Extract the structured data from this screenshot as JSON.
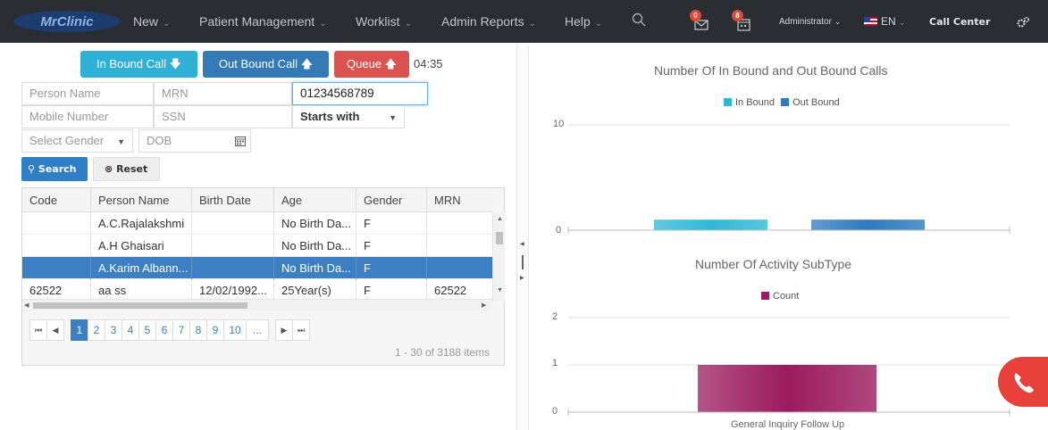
{
  "navbar": {
    "logo_text": "MrClinic",
    "menu": [
      {
        "label": "New"
      },
      {
        "label": "Patient Management"
      },
      {
        "label": "Worklist"
      },
      {
        "label": "Admin Reports"
      },
      {
        "label": "Help"
      }
    ],
    "mail_badge": "0",
    "calendar_badge": "8",
    "user": "Administrator",
    "language": "EN",
    "call_center": "Call Center"
  },
  "call_buttons": {
    "inbound": "In Bound Call",
    "outbound": "Out Bound Call",
    "queue": "Queue",
    "timer": "04:35"
  },
  "search_form": {
    "person_name_placeholder": "Person Name",
    "mrn_placeholder": "MRN",
    "phone_value": "01234568789",
    "mobile_placeholder": "Mobile Number",
    "ssn_placeholder": "SSN",
    "match_mode": "Starts with",
    "gender_placeholder": "Select Gender",
    "dob_placeholder": "DOB",
    "search_label": "Search",
    "reset_label": "Reset"
  },
  "grid": {
    "columns": [
      "Code",
      "Person Name",
      "Birth Date",
      "Age",
      "Gender",
      "MRN"
    ],
    "rows": [
      [
        "",
        "A.C.Rajalakshmi",
        "",
        "No Birth Da...",
        "F",
        ""
      ],
      [
        "",
        "A.H Ghaisari",
        "",
        "No Birth Da...",
        "F",
        ""
      ],
      [
        "",
        "A.Karim Albann...",
        "",
        "No Birth Da...",
        "F",
        ""
      ],
      [
        "62522",
        "aa ss",
        "12/02/1992...",
        "25Year(s)",
        "F",
        "62522"
      ]
    ],
    "selected_row": 2,
    "pages": [
      "1",
      "2",
      "3",
      "4",
      "5",
      "6",
      "7",
      "8",
      "9",
      "10",
      "..."
    ],
    "current_page": "1",
    "info": "1 - 30 of 3188 items"
  },
  "chart_data": [
    {
      "type": "bar",
      "title": "Number Of In Bound and Out Bound Calls",
      "categories": [
        ""
      ],
      "series": [
        {
          "name": "In Bound",
          "values": [
            1
          ],
          "color": "#2fb8d6"
        },
        {
          "name": "Out Bound",
          "values": [
            1
          ],
          "color": "#2f79bd"
        }
      ],
      "yticks": [
        "0",
        "10"
      ],
      "ylim": [
        0,
        10
      ],
      "legend": "top"
    },
    {
      "type": "bar",
      "title": "Number Of Activity SubType",
      "categories": [
        "General Inquiry Follow Up"
      ],
      "series": [
        {
          "name": "Count",
          "values": [
            1
          ],
          "color": "#9b1b5f"
        }
      ],
      "yticks": [
        "0",
        "1",
        "2"
      ],
      "ylim": [
        0,
        2
      ],
      "legend": "top"
    }
  ]
}
